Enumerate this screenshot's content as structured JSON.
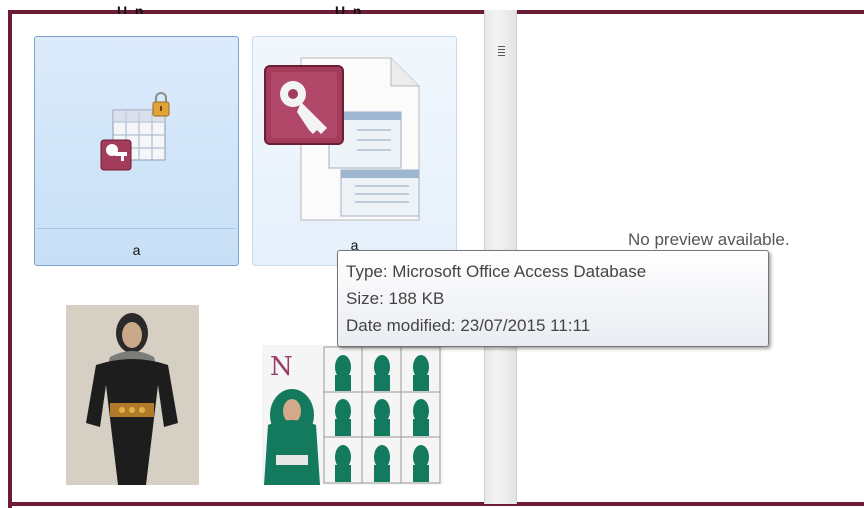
{
  "top_labels": [
    "U_n",
    "U_n"
  ],
  "items": [
    {
      "name": "a",
      "icon": "access-table-lock-icon",
      "state": "selected"
    },
    {
      "name": "a",
      "icon": "access-database-file-icon",
      "state": "hover"
    }
  ],
  "preview": {
    "message": "No preview available."
  },
  "tooltip": {
    "type": "Type: Microsoft Office Access Database",
    "size": "Size: 188 KB",
    "modified": "Date modified: 23/07/2015 11:11"
  },
  "thumbnails": [
    {
      "icon": "hijab-dress-drawing-image"
    },
    {
      "icon": "hijab-tutorial-collage-image"
    }
  ],
  "colors": {
    "frame": "#6b1d33",
    "selection": "#cfe3f8",
    "access": "#a33b5a"
  }
}
